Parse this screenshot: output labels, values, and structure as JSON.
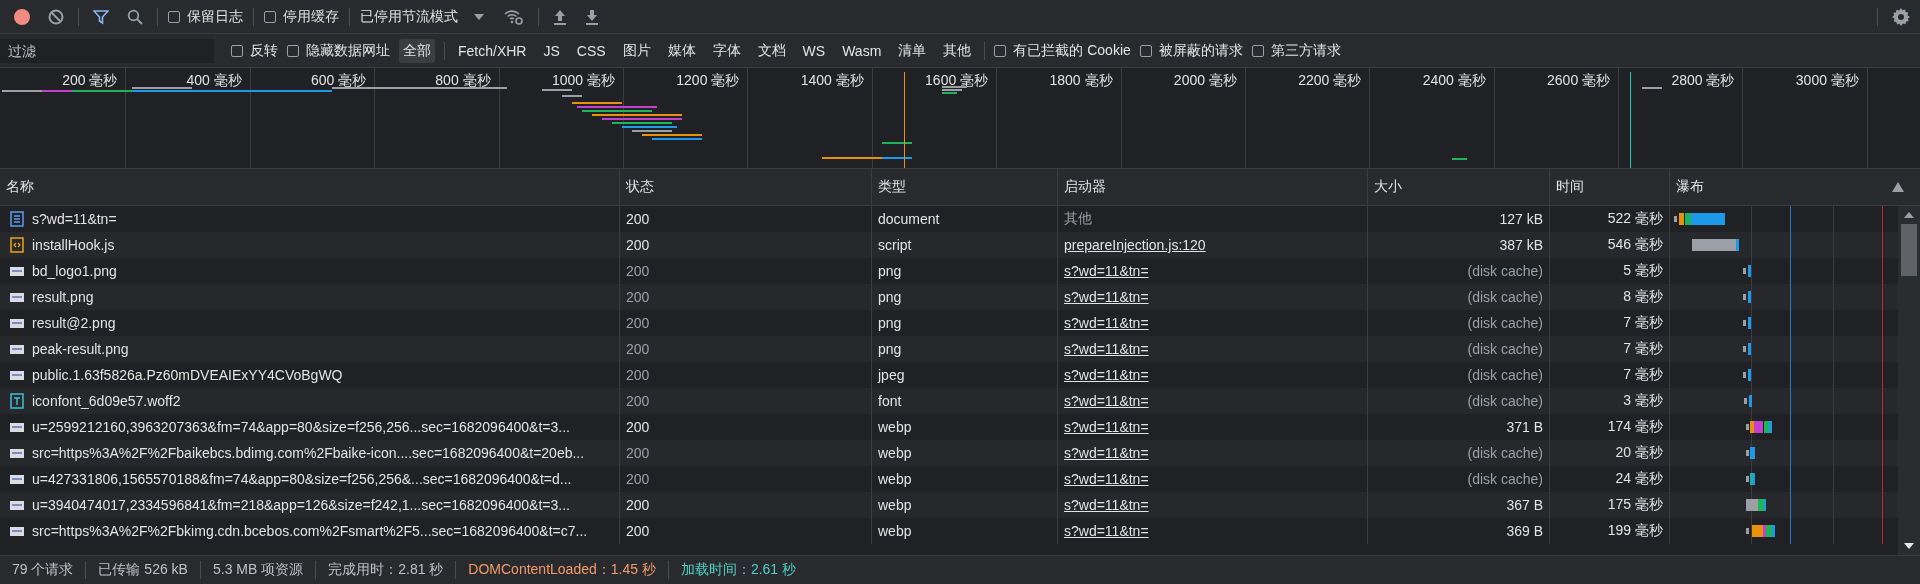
{
  "toolbar": {
    "recording": true,
    "filter_active": true,
    "checkboxes": [
      {
        "label": "保留日志",
        "checked": false
      },
      {
        "label": "停用缓存",
        "checked": false
      }
    ],
    "throttling": "已停用节流模式"
  },
  "filter_bar": {
    "placeholder": "过滤",
    "checkboxes": [
      {
        "label": "反转",
        "checked": false
      },
      {
        "label": "隐藏数据网址",
        "checked": false
      }
    ],
    "types": [
      {
        "label": "全部",
        "selected": true
      },
      {
        "label": "Fetch/XHR",
        "selected": false
      },
      {
        "label": "JS",
        "selected": false
      },
      {
        "label": "CSS",
        "selected": false
      },
      {
        "label": "图片",
        "selected": false
      },
      {
        "label": "媒体",
        "selected": false
      },
      {
        "label": "字体",
        "selected": false
      },
      {
        "label": "文档",
        "selected": false
      },
      {
        "label": "WS",
        "selected": false
      },
      {
        "label": "Wasm",
        "selected": false
      },
      {
        "label": "清单",
        "selected": false
      },
      {
        "label": "其他",
        "selected": false
      }
    ],
    "extra_checkboxes": [
      {
        "label": "有已拦截的 Cookie",
        "checked": false
      },
      {
        "label": "被屏蔽的请求",
        "checked": false
      },
      {
        "label": "第三方请求",
        "checked": false
      }
    ]
  },
  "overview": {
    "ticks": [
      "200 毫秒",
      "400 毫秒",
      "600 毫秒",
      "800 毫秒",
      "1000 毫秒",
      "1200 毫秒",
      "1400 毫秒",
      "1600 毫秒",
      "1800 毫秒",
      "2000 毫秒",
      "2200 毫秒",
      "2400 毫秒",
      "2600 毫秒",
      "2800 毫秒",
      "3000 毫秒"
    ]
  },
  "table": {
    "columns": [
      "名称",
      "状态",
      "类型",
      "启动器",
      "大小",
      "时间",
      "瀑布"
    ],
    "rows": [
      {
        "kind": "document",
        "name": "s?wd=11&tn=",
        "status": "200",
        "type": "document",
        "initiator": {
          "text": "其他",
          "link": false
        },
        "size": "127 kB",
        "time": "522 毫秒",
        "cached": false
      },
      {
        "kind": "script",
        "name": "installHook.js",
        "status": "200",
        "type": "script",
        "initiator": {
          "text": "prepareInjection.js:120",
          "link": true
        },
        "size": "387 kB",
        "time": "546 毫秒",
        "cached": false
      },
      {
        "kind": "image",
        "name": "bd_logo1.png",
        "status": "200",
        "type": "png",
        "initiator": {
          "text": "s?wd=11&tn=",
          "link": true
        },
        "size": "(disk cache)",
        "time": "5 毫秒",
        "cached": true
      },
      {
        "kind": "image",
        "name": "result.png",
        "status": "200",
        "type": "png",
        "initiator": {
          "text": "s?wd=11&tn=",
          "link": true
        },
        "size": "(disk cache)",
        "time": "8 毫秒",
        "cached": true
      },
      {
        "kind": "image",
        "name": "result@2.png",
        "status": "200",
        "type": "png",
        "initiator": {
          "text": "s?wd=11&tn=",
          "link": true
        },
        "size": "(disk cache)",
        "time": "7 毫秒",
        "cached": true
      },
      {
        "kind": "image",
        "name": "peak-result.png",
        "status": "200",
        "type": "png",
        "initiator": {
          "text": "s?wd=11&tn=",
          "link": true
        },
        "size": "(disk cache)",
        "time": "7 毫秒",
        "cached": true
      },
      {
        "kind": "image",
        "name": "public.1.63f5826a.Pz60mDVEAIExYY4CVoBgWQ",
        "status": "200",
        "type": "jpeg",
        "initiator": {
          "text": "s?wd=11&tn=",
          "link": true
        },
        "size": "(disk cache)",
        "time": "7 毫秒",
        "cached": true
      },
      {
        "kind": "font",
        "name": "iconfont_6d09e57.woff2",
        "status": "200",
        "type": "font",
        "initiator": {
          "text": "s?wd=11&tn=",
          "link": true
        },
        "size": "(disk cache)",
        "time": "3 毫秒",
        "cached": true
      },
      {
        "kind": "image",
        "name": "u=2599212160,3963207363&fm=74&app=80&size=f256,256...sec=1682096400&t=3...",
        "status": "200",
        "type": "webp",
        "initiator": {
          "text": "s?wd=11&tn=",
          "link": true
        },
        "size": "371 B",
        "time": "174 毫秒",
        "cached": false
      },
      {
        "kind": "image",
        "name": "src=https%3A%2F%2Fbaikebcs.bdimg.com%2Fbaike-icon....sec=1682096400&t=20eb...",
        "status": "200",
        "type": "webp",
        "initiator": {
          "text": "s?wd=11&tn=",
          "link": true
        },
        "size": "(disk cache)",
        "time": "20 毫秒",
        "cached": true
      },
      {
        "kind": "image",
        "name": "u=427331806,1565570188&fm=74&app=80&size=f256,256&...sec=1682096400&t=d...",
        "status": "200",
        "type": "webp",
        "initiator": {
          "text": "s?wd=11&tn=",
          "link": true
        },
        "size": "(disk cache)",
        "time": "24 毫秒",
        "cached": true
      },
      {
        "kind": "image",
        "name": "u=3940474017,2334596841&fm=218&app=126&size=f242,1...sec=1682096400&t=3...",
        "status": "200",
        "type": "webp",
        "initiator": {
          "text": "s?wd=11&tn=",
          "link": true
        },
        "size": "367 B",
        "time": "175 毫秒",
        "cached": false
      },
      {
        "kind": "image",
        "name": "src=https%3A%2F%2Fbkimg.cdn.bcebos.com%2Fsmart%2F5...sec=1682096400&t=c7...",
        "status": "200",
        "type": "webp",
        "initiator": {
          "text": "s?wd=11&tn=",
          "link": true
        },
        "size": "369 B",
        "time": "199 毫秒",
        "cached": false
      }
    ]
  },
  "status_bar": [
    {
      "text": "79 个请求",
      "kind": "plain"
    },
    {
      "text": "已传输 526 kB",
      "kind": "plain"
    },
    {
      "text": "5.3 MB 项资源",
      "kind": "plain"
    },
    {
      "text": "完成用时：2.81 秒",
      "kind": "plain"
    },
    {
      "text": "DOMContentLoaded：1.45 秒",
      "kind": "dom"
    },
    {
      "text": "加载时间：2.61 秒",
      "kind": "load"
    }
  ]
}
